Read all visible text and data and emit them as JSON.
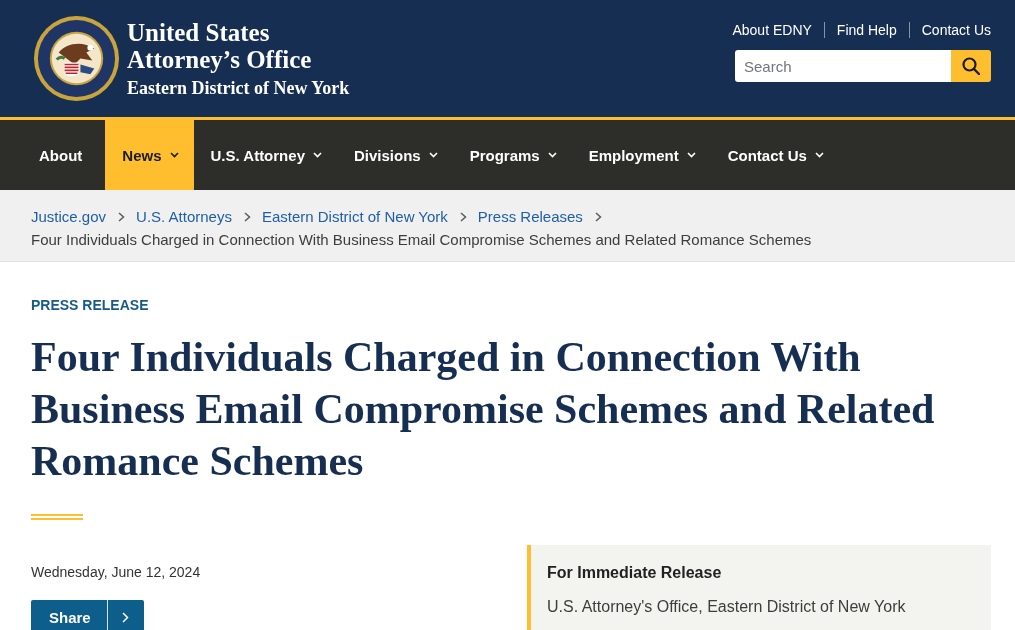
{
  "header": {
    "title_line_1": "United States",
    "title_line_2": "Attorney’s Office",
    "subtitle": "Eastern District of New York",
    "utility_links": [
      "About EDNY",
      "Find Help",
      "Contact Us"
    ],
    "search": {
      "placeholder": "Search"
    }
  },
  "nav": {
    "items": [
      {
        "label": "About",
        "has_menu": false,
        "selected": false
      },
      {
        "label": "News",
        "has_menu": true,
        "selected": true
      },
      {
        "label": "U.S. Attorney",
        "has_menu": true,
        "selected": false
      },
      {
        "label": "Divisions",
        "has_menu": true,
        "selected": false
      },
      {
        "label": "Programs",
        "has_menu": true,
        "selected": false
      },
      {
        "label": "Employment",
        "has_menu": true,
        "selected": false
      },
      {
        "label": "Contact Us",
        "has_menu": true,
        "selected": false
      }
    ]
  },
  "breadcrumb": {
    "links": [
      "Justice.gov",
      "U.S. Attorneys",
      "Eastern District of New York",
      "Press Releases"
    ],
    "current": "Four Individuals Charged in Connection With Business Email Compromise Schemes and Related Romance Schemes"
  },
  "article": {
    "eyebrow": "PRESS RELEASE",
    "title": "Four Individuals Charged in Connection With Business Email Compromise Schemes and Related Romance Schemes",
    "date": "Wednesday, June 12, 2024",
    "share": {
      "label": "Share"
    }
  },
  "release_box": {
    "heading": "For Immediate Release",
    "office": "U.S. Attorney's Office, Eastern District of New York"
  }
}
